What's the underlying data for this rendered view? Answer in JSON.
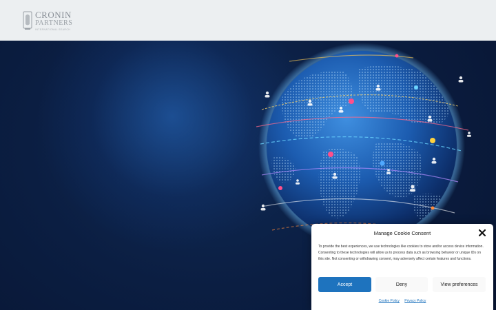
{
  "header": {
    "logo": {
      "line1": "CRONIN",
      "line2": "PARTNERS",
      "line3": "INTERNATIONAL SEARCH"
    }
  },
  "hero": {
    "image": "globe-network-people-icons"
  },
  "cookie_banner": {
    "title": "Manage Cookie Consent",
    "body": "To provide the best experiences, we use technologies like cookies to store and/or access device information. Consenting to these technologies will allow us to process data such as browsing behavior or unique IDs on this site. Not consenting or withdrawing consent, may adversely affect certain features and functions.",
    "accept_label": "Accept",
    "deny_label": "Deny",
    "preferences_label": "View preferences",
    "cookie_policy_label": "Cookie Policy",
    "privacy_policy_label": "Privacy Policy",
    "close_icon": "close-icon"
  },
  "colors": {
    "header_bg": "#eceff1",
    "hero_bg": "#0b1a36",
    "accent": "#1e73be"
  }
}
